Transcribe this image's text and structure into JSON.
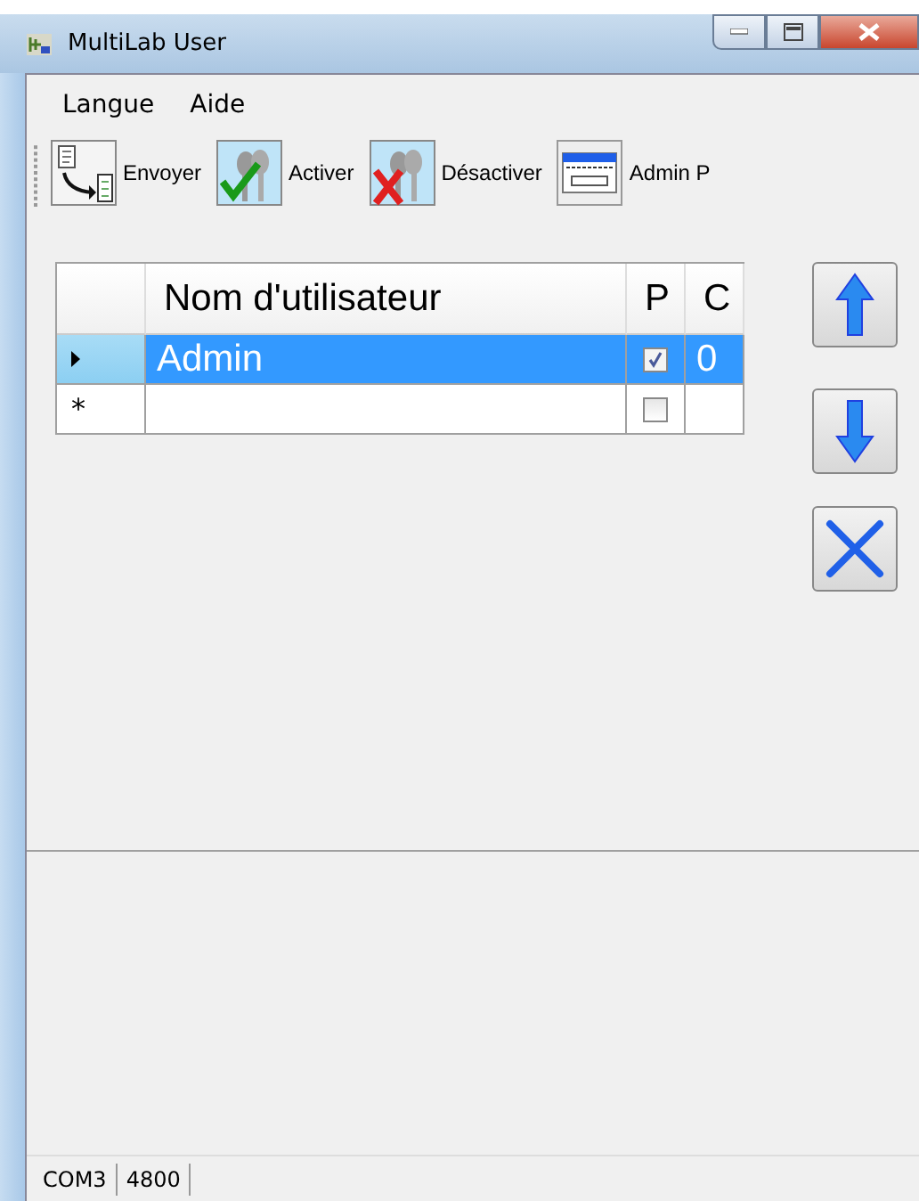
{
  "window": {
    "title": "MultiLab User"
  },
  "menu": [
    {
      "label": "Langue"
    },
    {
      "label": "Aide"
    }
  ],
  "toolbar": [
    {
      "kind": "send",
      "label": "Envoyer"
    },
    {
      "kind": "activate",
      "label": "Activer"
    },
    {
      "kind": "deactivate",
      "label": "Désactiver"
    },
    {
      "kind": "admin",
      "label": "Admin P"
    }
  ],
  "table": {
    "columns": [
      "Nom d'utilisateur",
      "P",
      "C"
    ],
    "rows": [
      {
        "selected": true,
        "current": true,
        "name": "Admin",
        "p_checked": true,
        "c": "0"
      },
      {
        "selected": false,
        "current": false,
        "new_mark": "*",
        "p_checked": false
      }
    ]
  },
  "side_buttons": [
    {
      "kind": "up"
    },
    {
      "kind": "down"
    },
    {
      "kind": "delete"
    }
  ],
  "status_bar": [
    "COM3",
    "4800"
  ]
}
